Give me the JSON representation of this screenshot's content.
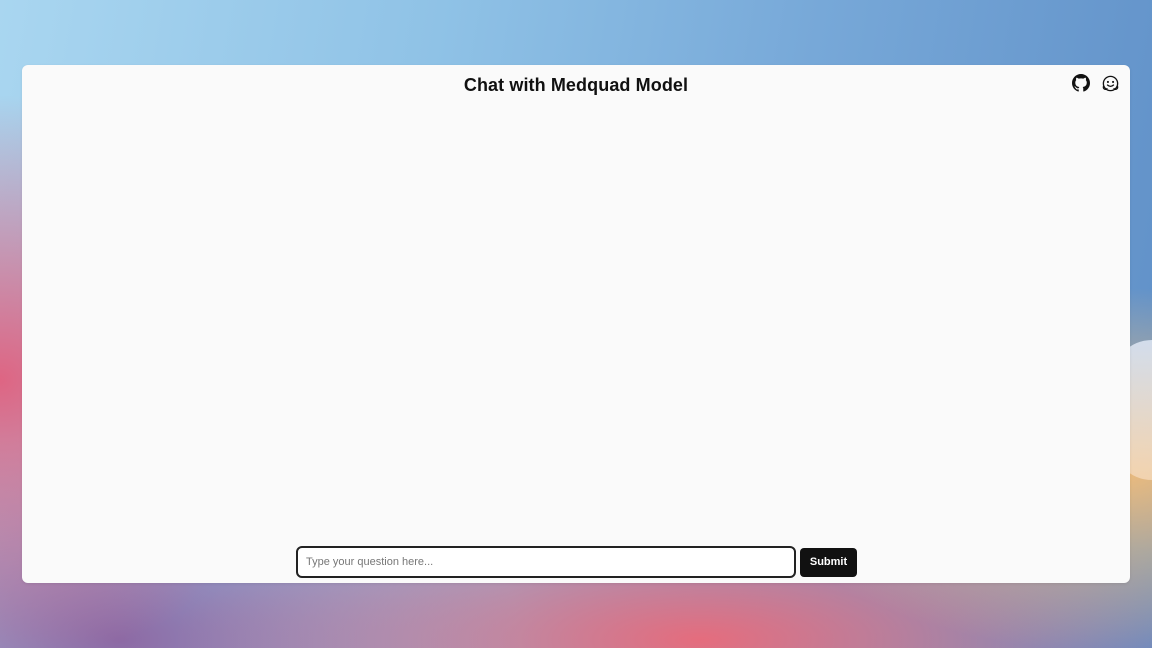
{
  "app": {
    "title": "Chat with Medquad Model"
  },
  "header": {
    "icons": [
      "github-icon",
      "huggingface-icon"
    ]
  },
  "composer": {
    "placeholder": "Type your question here...",
    "value": "",
    "submit_label": "Submit"
  },
  "colors": {
    "window_bg": "#fafafa",
    "button_bg": "#111111",
    "button_text": "#ffffff"
  }
}
